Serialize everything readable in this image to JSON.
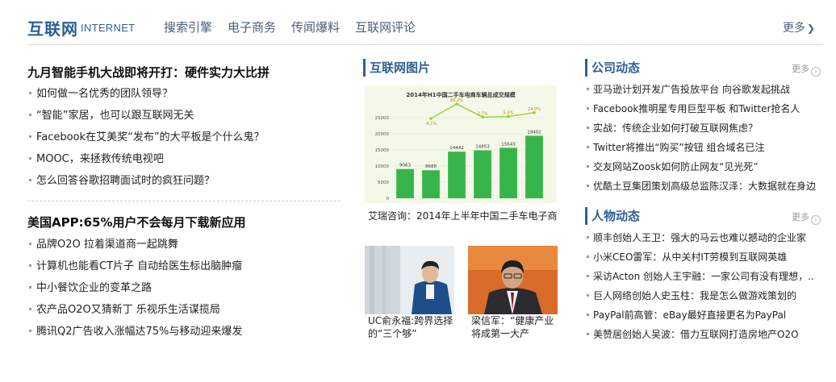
{
  "header": {
    "brand_cn": "互联网",
    "brand_en": "INTERNET",
    "nav": [
      "搜索引擎",
      "电子商务",
      "传闻爆料",
      "互联网评论"
    ],
    "more_label": "更多"
  },
  "left": {
    "block1": {
      "headline": "九月智能手机大战即将开打：硬件实力大比拼",
      "items": [
        "如何做一名优秀的团队领导？",
        "“智能”家居，也可以跟互联网无关",
        "Facebook在艾美奖“发布”的大平板是个什么鬼？",
        "MOOC，来拯救传统电视吧",
        "怎么回答谷歌招聘面试时的疯狂问题？"
      ]
    },
    "block2": {
      "headline": "美国APP:65%用户不会每月下载新应用",
      "items": [
        "品牌O2O 拉着渠道商一起跳舞",
        "计算机也能看CT片子 自动给医生标出脑肿瘤",
        "中小餐饮企业的变革之路",
        "农产品O2O又猜新丁 乐视乐生活谋揽局",
        "腾讯Q2广告收入涨幅达75%与移动迎来爆发"
      ]
    }
  },
  "pictures": {
    "title": "互联网图片",
    "chart_caption": "艾瑞咨询：2014年上半年中国二手车电子商",
    "photo1_caption": "UC俞永福:跨界选择的“三个够”",
    "photo2_caption": "梁信军：“健康产业将成第一大产"
  },
  "chart_data": {
    "type": "bar",
    "title": "2014年H1中国二手车电商车辆总成交规模",
    "categories": [
      "",
      "",
      "",
      "",
      "",
      ""
    ],
    "values": [
      9063,
      8688,
      14442,
      14853,
      15643,
      19402
    ],
    "value_labels": [
      "9063",
      "8688",
      "14442",
      "14853",
      "15643",
      "19402"
    ],
    "growth": [
      null,
      -4.1,
      66.2,
      2.7,
      5.5,
      24.0
    ],
    "growth_labels": [
      "",
      "-4.1%",
      "66.2%",
      "2.7%",
      "5.5%",
      "24.0%"
    ],
    "yticks": [
      "25000",
      "20000",
      "15000",
      "10000",
      "5000",
      "0"
    ],
    "ylim": [
      0,
      25000
    ],
    "bar_color": "#37b54a",
    "line_color": "#9ccc3a"
  },
  "company": {
    "title": "公司动态",
    "more_label": "更多",
    "items": [
      "亚马逊计划开发广告投放平台 向谷歌发起挑战",
      "Facebook推明星专用巨型平板 和Twitter抢名人",
      "实战：传统企业如何打破互联网焦虑？",
      "Twitter将推出“购买”按钮 组合域名已注",
      "交友网站Zoosk如何防止网友“见光死”",
      "优酷土豆集团策划高级总监陈汉泽：大数据就在身边"
    ]
  },
  "people": {
    "title": "人物动态",
    "more_label": "更多",
    "items": [
      "顺丰创始人王卫：强大的马云也难以撼动的企业家",
      "小米CEO雷军：从中关村IT劳模到互联网英雄",
      "采访Acton 创始人王宇融：一家公司有没有理想，..",
      "巨人网络创始人史玉柱：我是怎么做游戏策划的",
      "PayPal前高管：eBay最好直接更名为PayPal",
      "美赞居创始人吴波：借力互联网打造房地产O2O"
    ]
  },
  "colors": {
    "brand": "#2f5f96",
    "nav": "#4a5f7a"
  }
}
